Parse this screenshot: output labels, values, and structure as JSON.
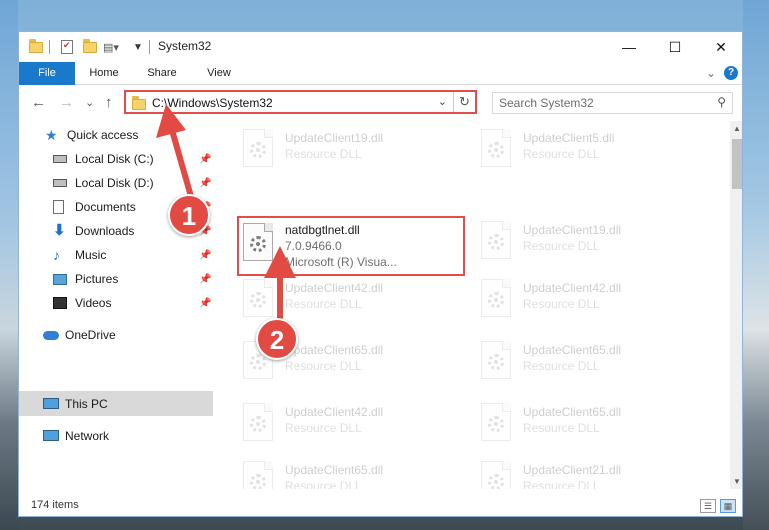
{
  "window": {
    "title": "System32",
    "controls": {
      "minimize": "—",
      "maximize": "☐",
      "close": "✕"
    }
  },
  "ribbon": {
    "tabs": [
      "File",
      "Home",
      "Share",
      "View"
    ],
    "collapse_glyph": "⌄",
    "help_glyph": "?"
  },
  "nav": {
    "back": "←",
    "forward": "→",
    "recent": "⌄",
    "up": "↑",
    "address": "C:\\Windows\\System32",
    "address_drop": "⌄",
    "refresh": "↻",
    "search_placeholder": "Search System32",
    "search_glyph": "⚲"
  },
  "sidebar": {
    "pin_glyph": "📌",
    "items": [
      {
        "label": "Quick access",
        "icon": "star-icon",
        "pinned": false
      },
      {
        "label": "Local Disk (C:)",
        "icon": "drive-icon",
        "pinned": true
      },
      {
        "label": "Local Disk (D:)",
        "icon": "drive-icon",
        "pinned": true
      },
      {
        "label": "Documents",
        "icon": "documents-icon",
        "pinned": true
      },
      {
        "label": "Downloads",
        "icon": "downloads-icon",
        "pinned": true
      },
      {
        "label": "Music",
        "icon": "music-icon",
        "pinned": true
      },
      {
        "label": "Pictures",
        "icon": "pictures-icon",
        "pinned": true
      },
      {
        "label": "Videos",
        "icon": "videos-icon",
        "pinned": true
      },
      {
        "label": "OneDrive",
        "icon": "onedrive-icon",
        "pinned": false
      },
      {
        "label": "This PC",
        "icon": "this-pc-icon",
        "pinned": false,
        "selected": true
      },
      {
        "label": "Network",
        "icon": "network-icon",
        "pinned": false
      }
    ]
  },
  "files": {
    "left": [
      {
        "name": "UpdateClient19.dll",
        "type": "Resource DLL"
      },
      {
        "name": "natdbgtlnet.dll",
        "version": "7.0.9466.0",
        "company": "Microsoft (R) Visua..."
      },
      {
        "name": "UpdateClient42.dll",
        "type": "Resource DLL"
      },
      {
        "name": "UpdateClient65.dll",
        "type": "Resource DLL"
      },
      {
        "name": "UpdateClient42.dll",
        "type": "Resource DLL"
      },
      {
        "name": "UpdateClient65.dll",
        "type": "Resource DLL"
      }
    ],
    "right": [
      {
        "name": "UpdateClient5.dll",
        "type": "Resource DLL"
      },
      {
        "name": "UpdateClient19.dll",
        "type": "Resource DLL"
      },
      {
        "name": "UpdateClient42.dll",
        "type": "Resource DLL"
      },
      {
        "name": "UpdateClient65.dll",
        "type": "Resource DLL"
      },
      {
        "name": "UpdateClient65.dll",
        "type": "Resource DLL"
      },
      {
        "name": "UpdateClient21.dll",
        "type": "Resource DLL"
      }
    ]
  },
  "status": {
    "count": "174 items",
    "details_view": "☰",
    "tiles_view": "▦"
  },
  "annotations": {
    "step1": "1",
    "step2": "2",
    "arrow_color": "#e24a44"
  }
}
